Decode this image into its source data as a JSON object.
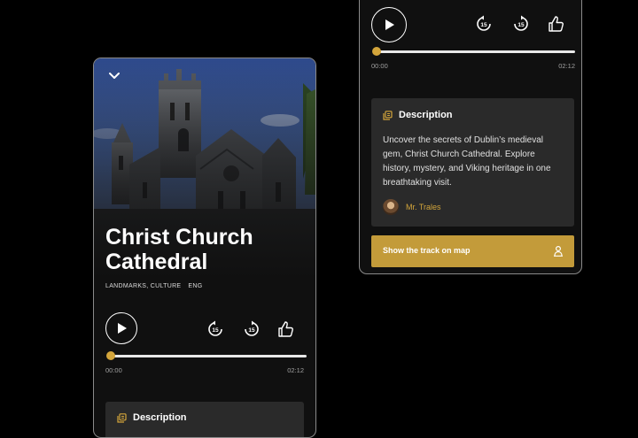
{
  "left_screen": {
    "title": "Christ Church Cathedral",
    "tags": [
      "LANDMARKS, CULTURE",
      "ENG"
    ],
    "player": {
      "elapsed": "00:00",
      "duration": "02:12",
      "progress": 0,
      "rewind_seconds": "15",
      "forward_seconds": "15"
    },
    "description": {
      "heading": "Description"
    },
    "icons": [
      "chevron-down-icon",
      "play-icon",
      "rewind-15-icon",
      "forward-15-icon",
      "thumbs-up-icon",
      "description-icon"
    ]
  },
  "right_screen": {
    "player": {
      "elapsed": "00:00",
      "duration": "02:12",
      "progress": 0,
      "rewind_seconds": "15",
      "forward_seconds": "15"
    },
    "description": {
      "heading": "Description",
      "text": "Uncover the secrets of Dublin’s medieval gem, Christ Church Cathedral. Explore history, mystery, and Viking heritage in one breathtaking visit.",
      "author": "Mr. Trales"
    },
    "map_button": {
      "label": "Show the track on map"
    },
    "icons": [
      "play-icon",
      "rewind-15-icon",
      "forward-15-icon",
      "thumbs-up-icon",
      "description-icon",
      "avatar",
      "person-pin-icon"
    ]
  },
  "colors": {
    "background": "#000000",
    "panel": "#101010",
    "card": "#2a2a2a",
    "accent": "#d3a53b",
    "button": "#c39b3a",
    "track": "#e8e8e8"
  }
}
